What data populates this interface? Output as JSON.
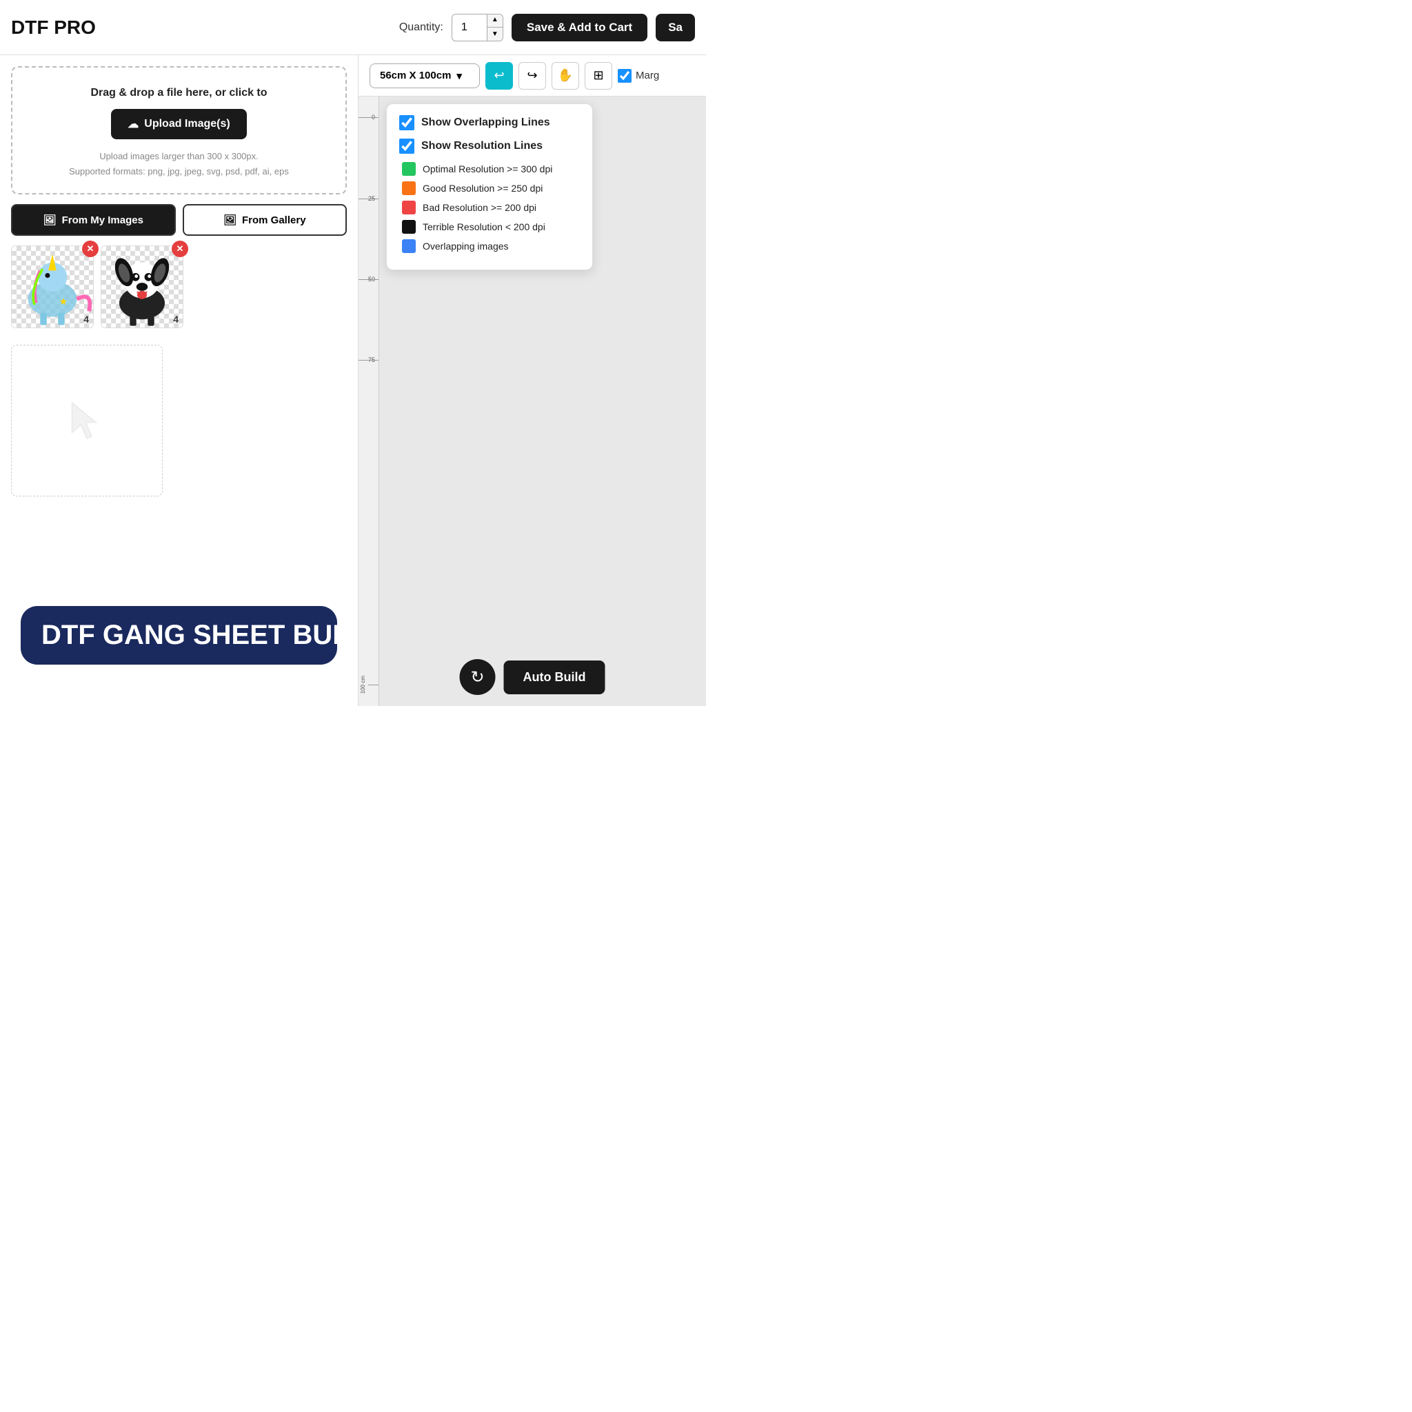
{
  "app": {
    "title": "DTF PRO"
  },
  "header": {
    "quantity_label": "Quantity:",
    "quantity_value": "1",
    "save_cart_label": "Save & Add to Cart",
    "save_label": "Sa"
  },
  "toolbar": {
    "size_label": "56cm X 100cm",
    "margins_label": "Marg",
    "undo_icon": "↩",
    "redo_icon": "↪",
    "pan_icon": "✋",
    "grid_icon": "⊞"
  },
  "left_panel": {
    "upload_text": "Drag & drop a file here, or click to",
    "upload_btn": "Upload Image(s)",
    "hint1": "Upload images larger than 300 x 300px.",
    "hint2": "Supported formats: png, jpg, jpeg, svg, psd, pdf, ai, eps",
    "from_my_images": "From My Images",
    "from_gallery": "From Gallery",
    "images": [
      {
        "count": "4",
        "alt": "unicorn"
      },
      {
        "count": "4",
        "alt": "dog"
      }
    ]
  },
  "dropdown": {
    "show_overlapping_lines": "Show Overlapping Lines",
    "show_resolution_lines": "Show Resolution Lines",
    "legend": [
      {
        "color": "#22c55e",
        "label": "Optimal Resolution >= 300 dpi"
      },
      {
        "color": "#f97316",
        "label": "Good Resolution >= 250 dpi"
      },
      {
        "color": "#ef4444",
        "label": "Bad Resolution >= 200 dpi"
      },
      {
        "color": "#111111",
        "label": "Terrible Resolution < 200 dpi"
      },
      {
        "color": "#3b82f6",
        "label": "Overlapping images"
      }
    ]
  },
  "banner": {
    "title": "DTF GANG SHEET BUILDER"
  },
  "bottom_toolbar": {
    "auto_build_label": "Auto Build",
    "refresh_icon": "↻"
  },
  "ruler": {
    "unit_label": "100 cm",
    "marks": [
      "0",
      "25",
      "50",
      "75"
    ]
  }
}
